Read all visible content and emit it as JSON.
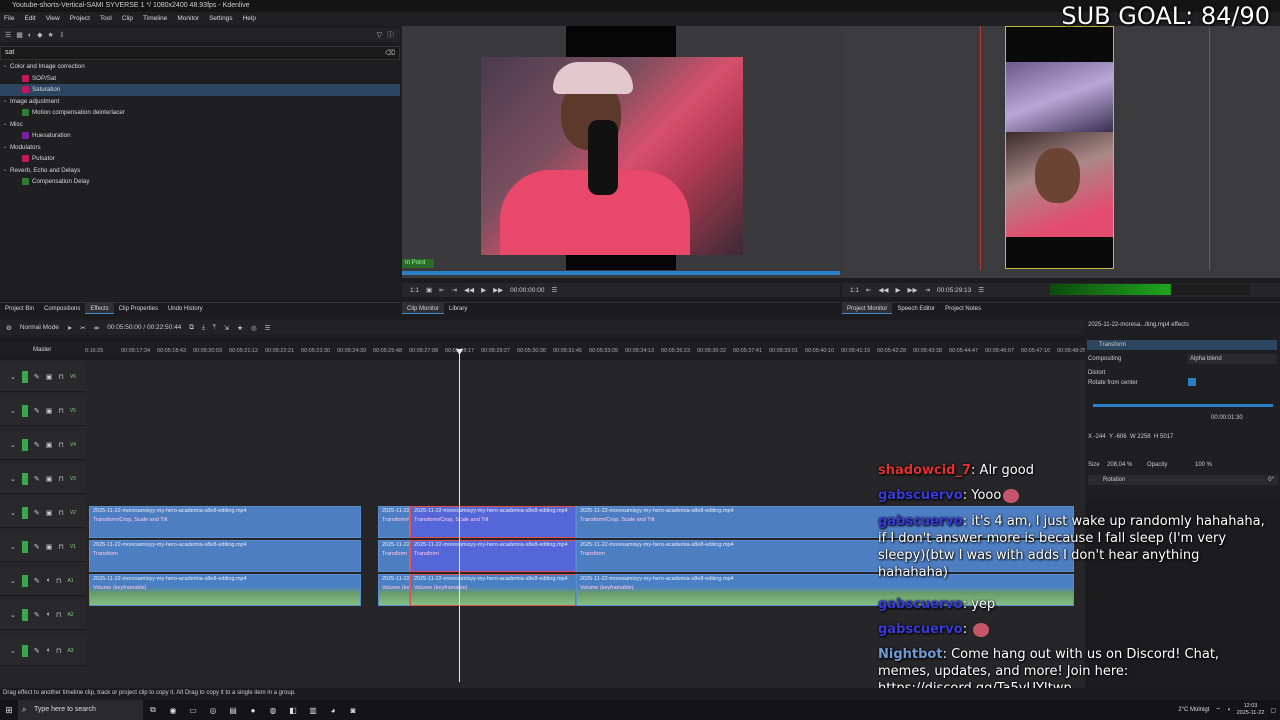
{
  "window": {
    "title": "Youtube-shorts-Vertical-SAMI SYVERSE 1 */ 1080x2400 48.93fps - Kdenlive"
  },
  "menu": [
    "File",
    "Edit",
    "View",
    "Project",
    "Tool",
    "Clip",
    "Timeline",
    "Monitor",
    "Settings",
    "Help"
  ],
  "effects_panel": {
    "search_value": "sat",
    "tree": [
      {
        "type": "category",
        "label": "Color and Image correction"
      },
      {
        "type": "item",
        "label": "SOP/Sat",
        "color": "#c2185b",
        "selected": false
      },
      {
        "type": "item",
        "label": "Saturation",
        "color": "#c2185b",
        "selected": true
      },
      {
        "type": "category",
        "label": "Image adjustment"
      },
      {
        "type": "item",
        "label": "Motion compensation deinterlacer",
        "color": "#2e7d32",
        "selected": false
      },
      {
        "type": "category",
        "label": "Misc"
      },
      {
        "type": "item",
        "label": "Huesaturation",
        "color": "#7b1fa2",
        "selected": false
      },
      {
        "type": "category",
        "label": "Modulators"
      },
      {
        "type": "item",
        "label": "Pulsator",
        "color": "#c2185b",
        "selected": false
      },
      {
        "type": "category",
        "label": "Reverb, Echo and Delays"
      },
      {
        "type": "item",
        "label": "Compensation Delay",
        "color": "#2e7d32",
        "selected": false
      }
    ],
    "tabs": [
      "Project Bin",
      "Compositions",
      "Effects",
      "Clip Properties",
      "Undo History"
    ],
    "active_tab": "Effects"
  },
  "clip_monitor": {
    "in_point_label": "In Point",
    "zoom": "1:1",
    "timecode": "00:00:00:00",
    "tabs": [
      "Clip Monitor",
      "Library"
    ],
    "active_tab": "Clip Monitor"
  },
  "project_monitor": {
    "zoom": "1:1",
    "timecode": "00:05:29:13",
    "tabs": [
      "Project Monitor",
      "Speech Editor",
      "Project Notes"
    ],
    "active_tab": "Project Monitor"
  },
  "overlay": {
    "sub_goal": "SUB GOAL: 84/90"
  },
  "timeline": {
    "mode": "Normal Mode",
    "position": "00:05:50:00 / 00:22:50:44",
    "master_label": "Master",
    "ruler_ticks": [
      "0:16:25",
      "00:05:17:34",
      "00:05:18:43",
      "00:05:20:03",
      "00:05:21:12",
      "00:05:22:21",
      "00:05:23:30",
      "00:05:24:39",
      "00:05:25:48",
      "00:05:27:08",
      "00:05:28:17",
      "00:05:29:27",
      "00:05:30:36",
      "00:05:31:45",
      "00:05:33:05",
      "00:05:34:13",
      "00:05:35:23",
      "00:05:36:32",
      "00:05:37:41",
      "00:05:39:01",
      "00:05:40:10",
      "00:05:41:19",
      "00:05:42:28",
      "00:05:43:38",
      "00:05:44:47",
      "00:05:46:07",
      "00:05:47:16",
      "00:05:48:25"
    ],
    "tracks": [
      {
        "label": "V6",
        "kind": "video"
      },
      {
        "label": "V5",
        "kind": "video"
      },
      {
        "label": "V4",
        "kind": "video"
      },
      {
        "label": "V3",
        "kind": "video"
      },
      {
        "label": "V2",
        "kind": "video"
      },
      {
        "label": "V1",
        "kind": "video"
      },
      {
        "label": "A1",
        "kind": "audio"
      },
      {
        "label": "A2",
        "kind": "audio"
      },
      {
        "label": "A3",
        "kind": "audio"
      }
    ],
    "clip_name": "2025-11-22-moresamisyy-my-hero-academia-s8e8-editing.mp4",
    "clip_name_short": "2025-11-22-m",
    "effect_v2": "Transform/Crop, Scale and Tilt",
    "effect_v1": "Transform",
    "effect_a1": "Volume (keyframable)"
  },
  "effect_stack": {
    "title": "2025-11-22-moresa...iting.mp4 effects",
    "effect_name": "Transform",
    "compositing_label": "Compositing",
    "compositing_value": "Alpha blend",
    "distort_label": "Distort",
    "rotate_label": "Rotate from center",
    "timecode": "00:00:01:30",
    "x": "-244",
    "y": "-606",
    "w": "2258",
    "h": "5017",
    "size": "208,04 %",
    "opacity_label": "Opacity",
    "opacity": "100 %",
    "rotation_label": "Rotation",
    "rotation_value": "0°"
  },
  "chat": [
    {
      "user": "shadowcid_7",
      "user_color": "#e03030",
      "text": "Alr good"
    },
    {
      "user": "gabscuervo",
      "user_color": "#3a3ad6",
      "text": "Yooo"
    },
    {
      "user": "gabscuervo",
      "user_color": "#3a3ad6",
      "text": "it's 4 am, I just wake up randomly hahahaha, if I don't answer more is because I fall sleep (I'm very sleepy)(btw I was with adds I don't hear anything hahahaha)"
    },
    {
      "user": "gabscuervo",
      "user_color": "#3a3ad6",
      "text": "yep"
    },
    {
      "user": "gabscuervo",
      "user_color": "#3a3ad6",
      "text": ""
    },
    {
      "user": "Nightbot",
      "user_color": "#6f9ad6",
      "text": "Come hang out with us on Discord! Chat, memes, updates, and more! Join here: https://discord.gg/Ta5vUYJtwp"
    }
  ],
  "status": {
    "message": "Drag effect to another timeline clip, track or project clip to copy it. Alt Drag to copy it to a single item in a group."
  },
  "taskbar": {
    "search_placeholder": "Type here to search",
    "weather": "2°C Molnigt",
    "time": "12:03",
    "date": "2025-11-22"
  }
}
